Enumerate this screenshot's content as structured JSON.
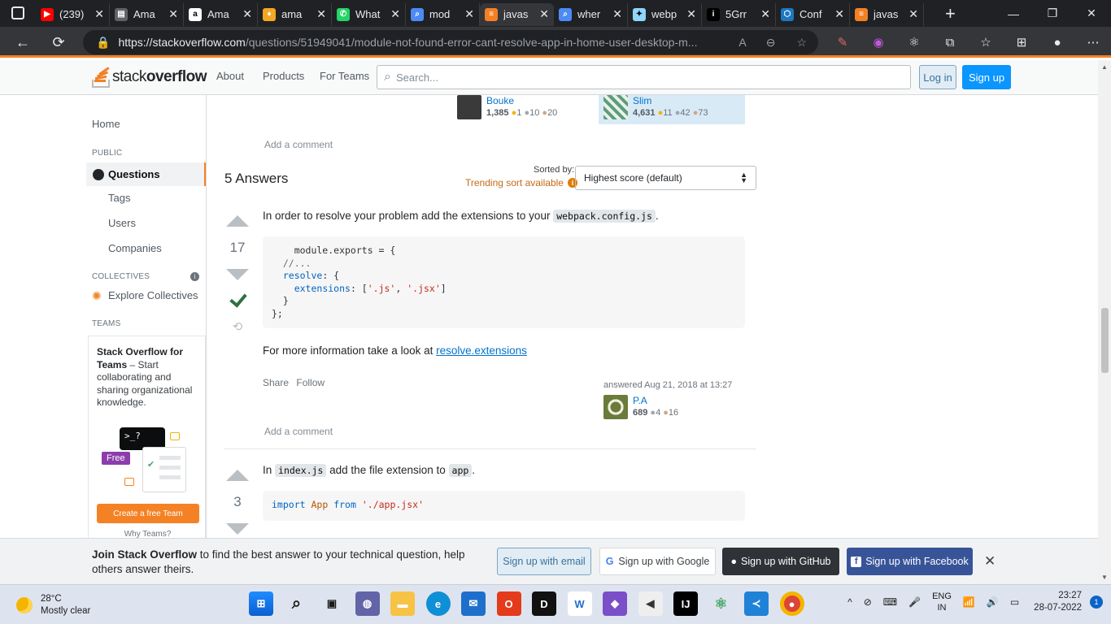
{
  "browser": {
    "tabs": [
      {
        "title": "(239)",
        "icon": "youtube-icon",
        "color": "#ff0000",
        "glyph": "▶"
      },
      {
        "title": "Ama",
        "icon": "document-icon",
        "color": "#5f6368",
        "glyph": "▤"
      },
      {
        "title": "Ama",
        "icon": "amazon-icon",
        "color": "#ffffff",
        "glyph": "a"
      },
      {
        "title": "ama",
        "icon": "flame-icon",
        "color": "#f5a623",
        "glyph": "♦"
      },
      {
        "title": "What",
        "icon": "whatsapp-icon",
        "color": "#25d366",
        "glyph": "✆"
      },
      {
        "title": "mod",
        "icon": "search-icon",
        "color": "#4c8bf5",
        "glyph": "⌕"
      },
      {
        "title": "javas",
        "icon": "stackoverflow-icon",
        "color": "#f48024",
        "glyph": "≡"
      },
      {
        "title": "wher",
        "icon": "search-icon",
        "color": "#4c8bf5",
        "glyph": "⌕"
      },
      {
        "title": "webp",
        "icon": "webpack-icon",
        "color": "#8ed6fb",
        "glyph": "✦"
      },
      {
        "title": "5Grr",
        "icon": "info-icon",
        "color": "#000000",
        "glyph": "i"
      },
      {
        "title": "Conf",
        "icon": "cube-icon",
        "color": "#1c78c0",
        "glyph": "⬡"
      },
      {
        "title": "javas",
        "icon": "stackoverflow-icon",
        "color": "#f48024",
        "glyph": "≡"
      }
    ],
    "url_host": "https://stackoverflow.com",
    "url_path": "/questions/51949041/module-not-found-error-cant-resolve-app-in-home-user-desktop-m..."
  },
  "so_header": {
    "logo_light": "stack",
    "logo_bold": "overflow",
    "nav": [
      "About",
      "Products",
      "For Teams"
    ],
    "search_placeholder": "Search...",
    "login": "Log in",
    "signup": "Sign up"
  },
  "left_nav": {
    "home": "Home",
    "public_head": "PUBLIC",
    "questions": "Questions",
    "tags": "Tags",
    "users": "Users",
    "companies": "Companies",
    "collectives_head": "COLLECTIVES",
    "explore": "Explore Collectives",
    "teams_head": "TEAMS",
    "teams_title": "Stack Overflow for Teams",
    "teams_desc": " – Start collaborating and sharing organizational knowledge.",
    "free_badge": "Free",
    "create_team": "Create a free Team",
    "why_teams": "Why Teams?"
  },
  "question_footer": {
    "editor": {
      "name": "Bouke",
      "rep": "1,385",
      "gold": "1",
      "silver": "10",
      "bronze": "20"
    },
    "asker": {
      "name": "Slim",
      "rep": "4,631",
      "gold": "11",
      "silver": "42",
      "bronze": "73"
    },
    "add_comment": "Add a comment"
  },
  "answers_header": {
    "count": "5 Answers",
    "sorted_by": "Sorted by:",
    "trending": "Trending sort available",
    "sort_value": "Highest score (default)"
  },
  "answer1": {
    "score": "17",
    "intro_prefix": "In order to resolve your problem add the extensions to your ",
    "intro_code": "webpack.config.js",
    "intro_suffix": ".",
    "code_lines": [
      "  module.exports = {",
      "//...",
      "resolve: {",
      "  extensions: ['.js', '.jsx']",
      "}",
      "};"
    ],
    "more_prefix": "For more information take a look at ",
    "more_link": "resolve.extensions",
    "share": "Share",
    "follow": "Follow",
    "answered": "answered Aug 21, 2018 at 13:27",
    "user": {
      "name": "P.A",
      "rep": "689",
      "silver": "4",
      "bronze": "16"
    },
    "add_comment": "Add a comment"
  },
  "answer2": {
    "score": "3",
    "intro_prefix": "In ",
    "code1": "index.js",
    "intro_mid": " add the file extension to ",
    "code2": "app",
    "intro_suffix": ".",
    "code_line": "import App from './app.jsx'"
  },
  "join_bar": {
    "bold": "Join Stack Overflow",
    "text": " to find the best answer to your technical question, help others answer theirs.",
    "email": "Sign up with email",
    "google": "Sign up with Google",
    "github": "Sign up with GitHub",
    "facebook": "Sign up with Facebook"
  },
  "taskbar": {
    "temp": "28°C",
    "weather": "Mostly clear",
    "lang1": "ENG",
    "lang2": "IN",
    "time": "23:27",
    "date": "28-07-2022",
    "notifications": "1"
  }
}
